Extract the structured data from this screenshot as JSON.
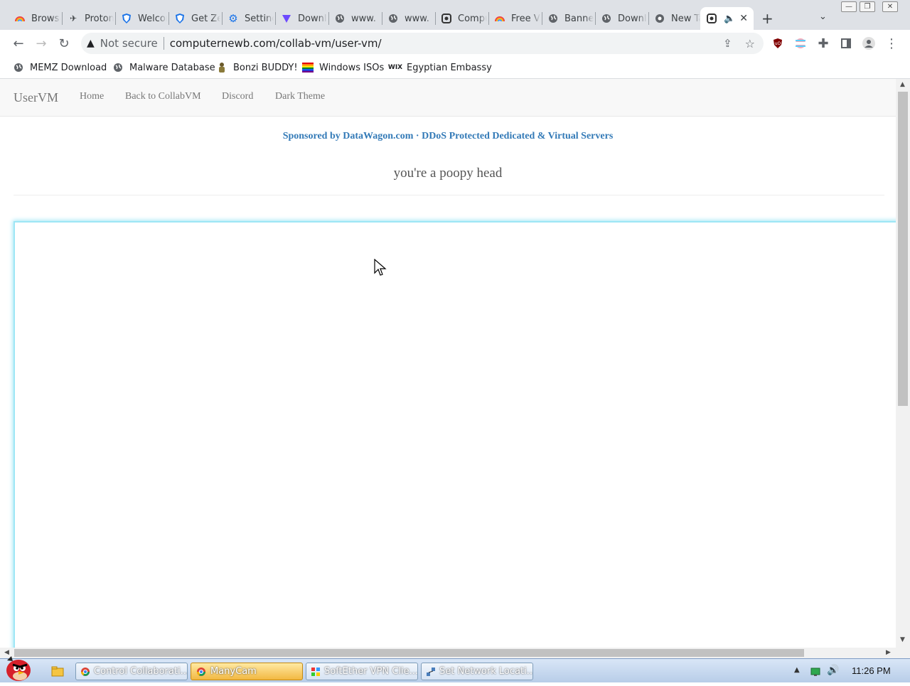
{
  "browser": {
    "tabs": [
      {
        "title": "Browser",
        "icon": "rainbow-icon"
      },
      {
        "title": "Proton",
        "icon": "paper-plane-icon"
      },
      {
        "title": "Welcome",
        "icon": "shield-icon"
      },
      {
        "title": "Get Zero",
        "icon": "shield-icon"
      },
      {
        "title": "Settings",
        "icon": "gear-icon"
      },
      {
        "title": "Download",
        "icon": "proton-vpn-icon"
      },
      {
        "title": "www.",
        "icon": "globe-icon"
      },
      {
        "title": "www.",
        "icon": "globe-icon"
      },
      {
        "title": "Computernewb",
        "icon": "collabvm-icon"
      },
      {
        "title": "Free VM",
        "icon": "rainbow-icon"
      },
      {
        "title": "Banner",
        "icon": "globe-icon"
      },
      {
        "title": "Download",
        "icon": "globe-icon"
      },
      {
        "title": "New Tab",
        "icon": "chrome-icon"
      }
    ],
    "active_tab": {
      "icon": "collabvm-icon",
      "audio_icon": "speaker-icon"
    },
    "address": {
      "security_label": "Not secure",
      "url": "computernewb.com/collab-vm/user-vm/"
    },
    "bookmarks": [
      {
        "label": "MEMZ Download",
        "icon": "globe-icon"
      },
      {
        "label": "Malware Database",
        "icon": "globe-icon"
      },
      {
        "label": "Bonzi BUDDY!",
        "icon": "bonzi-icon"
      },
      {
        "label": "Windows ISOs",
        "icon": "rainbow-flag-icon"
      },
      {
        "label": "Egyptian Embassy",
        "icon": "wix-icon"
      }
    ]
  },
  "site": {
    "brand": "UserVM",
    "nav": [
      "Home",
      "Back to CollabVM",
      "Discord",
      "Dark Theme"
    ],
    "sponsor": "Sponsored by DataWagon.com · DDoS Protected Dedicated & Virtual Servers",
    "motd": "you're a poopy head"
  },
  "taskbar": {
    "buttons": [
      {
        "label": "Control Collaborati...",
        "icon": "chrome-icon"
      },
      {
        "label": "ManyCam",
        "icon": "chrome-icon"
      },
      {
        "label": "SoftEther VPN Clie...",
        "icon": "softether-icon"
      },
      {
        "label": "Set Network Locati...",
        "icon": "network-icon"
      }
    ],
    "clock": "11:26 PM"
  },
  "colors": {
    "link": "#337ab7",
    "vm_border": "#9ee6f5",
    "tab_strip": "#dee1e6"
  }
}
